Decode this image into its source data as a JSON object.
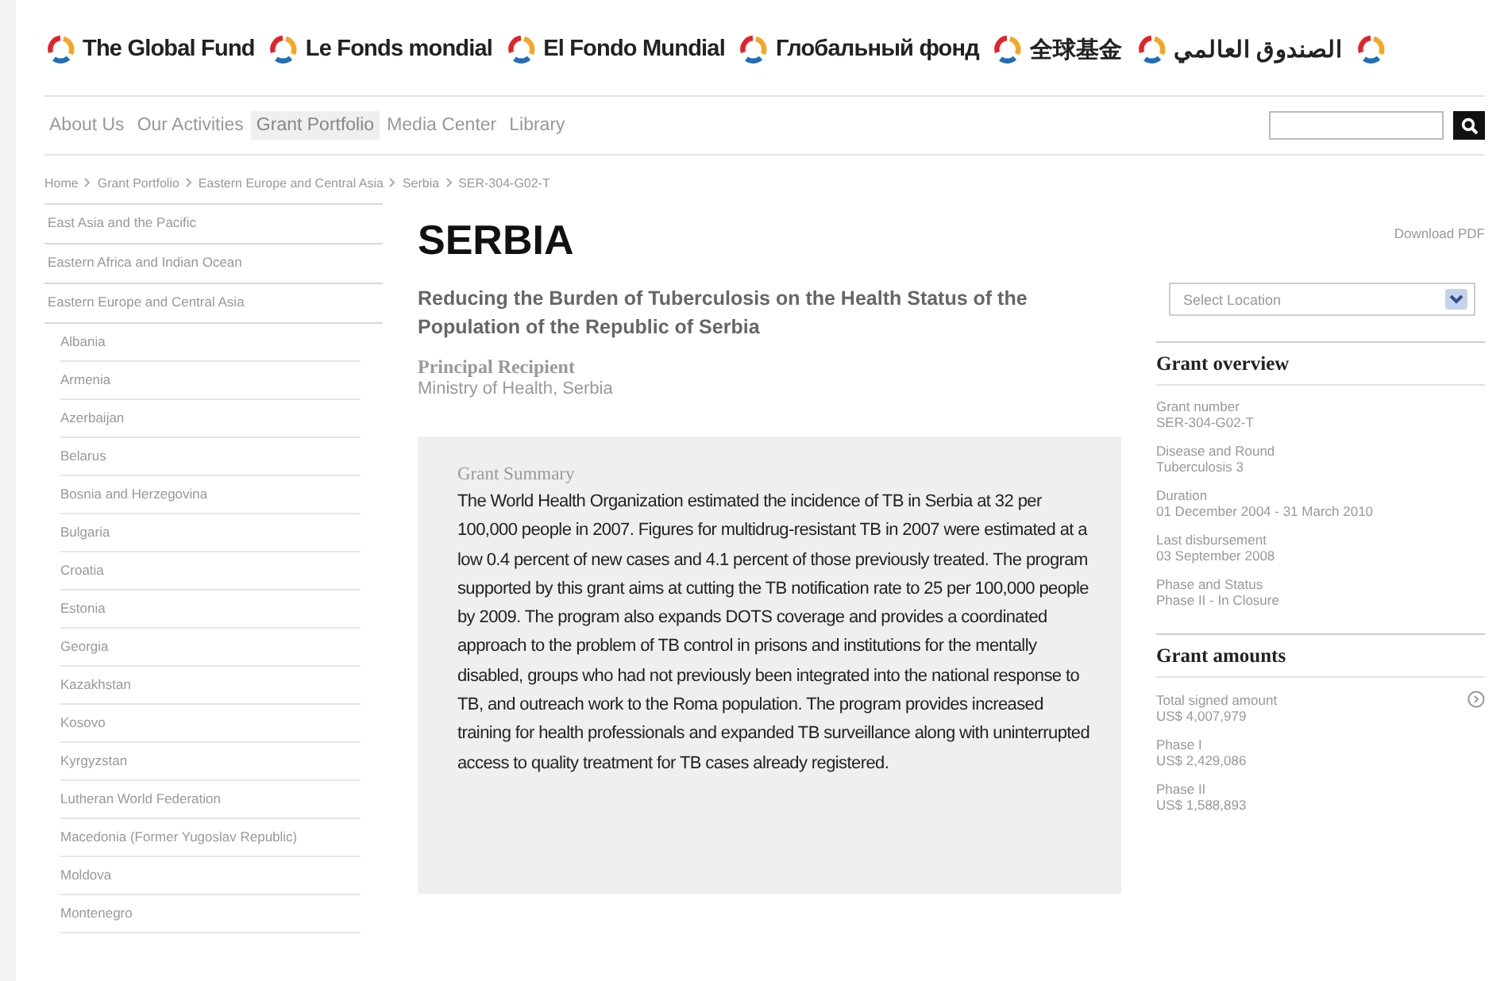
{
  "logos": [
    {
      "text": "The Global Fund"
    },
    {
      "text": "Le Fonds mondial"
    },
    {
      "text": "El Fondo Mundial"
    },
    {
      "text": "Глобальный фонд"
    },
    {
      "text": "全球基金"
    },
    {
      "text": "الصندوق العالمي"
    }
  ],
  "nav": [
    {
      "label": "About Us",
      "selected": false
    },
    {
      "label": "Our Activities",
      "selected": false
    },
    {
      "label": "Grant Portfolio",
      "selected": true
    },
    {
      "label": "Media Center",
      "selected": false
    },
    {
      "label": "Library",
      "selected": false
    }
  ],
  "breadcrumb": [
    "Home",
    "Grant Portfolio",
    "Eastern Europe and Central Asia",
    "Serbia",
    "SER-304-G02-T"
  ],
  "sidebar": {
    "items": [
      {
        "label": "East Asia and the Pacific",
        "expanded": false
      },
      {
        "label": "Eastern Africa and Indian Ocean",
        "expanded": false
      },
      {
        "label": "Eastern Europe and Central Asia",
        "expanded": true,
        "children": [
          {
            "label": "Albania"
          },
          {
            "label": "Armenia"
          },
          {
            "label": "Azerbaijan"
          },
          {
            "label": "Belarus"
          },
          {
            "label": "Bosnia and Herzegovina"
          },
          {
            "label": "Bulgaria"
          },
          {
            "label": "Croatia"
          },
          {
            "label": "Estonia"
          },
          {
            "label": "Georgia"
          },
          {
            "label": "Kazakhstan"
          },
          {
            "label": "Kosovo"
          },
          {
            "label": "Kyrgyzstan"
          },
          {
            "label": "Lutheran World Federation"
          },
          {
            "label": "Macedonia (Former Yugoslav Republic)"
          },
          {
            "label": "Moldova"
          },
          {
            "label": "Montenegro"
          }
        ]
      }
    ]
  },
  "main": {
    "title": "SERBIA",
    "subtitle": "Reducing the Burden of Tuberculosis on the Health Status of the Population of the Republic of Serbia",
    "recipient_label": "Principal Recipient",
    "recipient": "Ministry of Health, Serbia",
    "summary_title": "Grant Summary",
    "summary": "The World Health Organization estimated the incidence of TB in Serbia at 32 per 100,000 people in 2007. Figures for multidrug-resistant TB in 2007 were estimated at a low 0.4 percent of new cases and 4.1 percent of those previously treated. The program supported by this grant aims at cutting the TB notification rate to 25 per 100,000 people by 2009. The program also expands DOTS coverage and provides a coordinated approach to the problem of TB control in prisons and institutions for the mentally disabled, groups who had not previously been integrated into the national response to TB, and outreach work to the Roma population. The program provides increased training for health professionals and expanded TB surveillance along with uninterrupted access to quality treatment for TB cases already registered."
  },
  "right": {
    "download": "Download PDF",
    "location_placeholder": "Select Location",
    "sections": [
      {
        "title": "Grant overview",
        "fields": [
          {
            "label": "Grant number",
            "value": "SER-304-G02-T"
          },
          {
            "label": "Disease and Round",
            "value": "Tuberculosis 3"
          },
          {
            "label": "Duration",
            "value": "01 December 2004 - 31 March 2010"
          },
          {
            "label": "Last disbursement",
            "value": "03 September 2008"
          },
          {
            "label": "Phase and Status",
            "value": "Phase II - In Closure"
          }
        ]
      },
      {
        "title": "Grant amounts",
        "fields": [
          {
            "label": "Total signed amount",
            "value": "US$ 4,007,979",
            "info": true
          },
          {
            "label": "Phase I",
            "value": "US$ 2,429,086"
          },
          {
            "label": "Phase II",
            "value": "US$ 1,588,893"
          }
        ]
      }
    ]
  }
}
